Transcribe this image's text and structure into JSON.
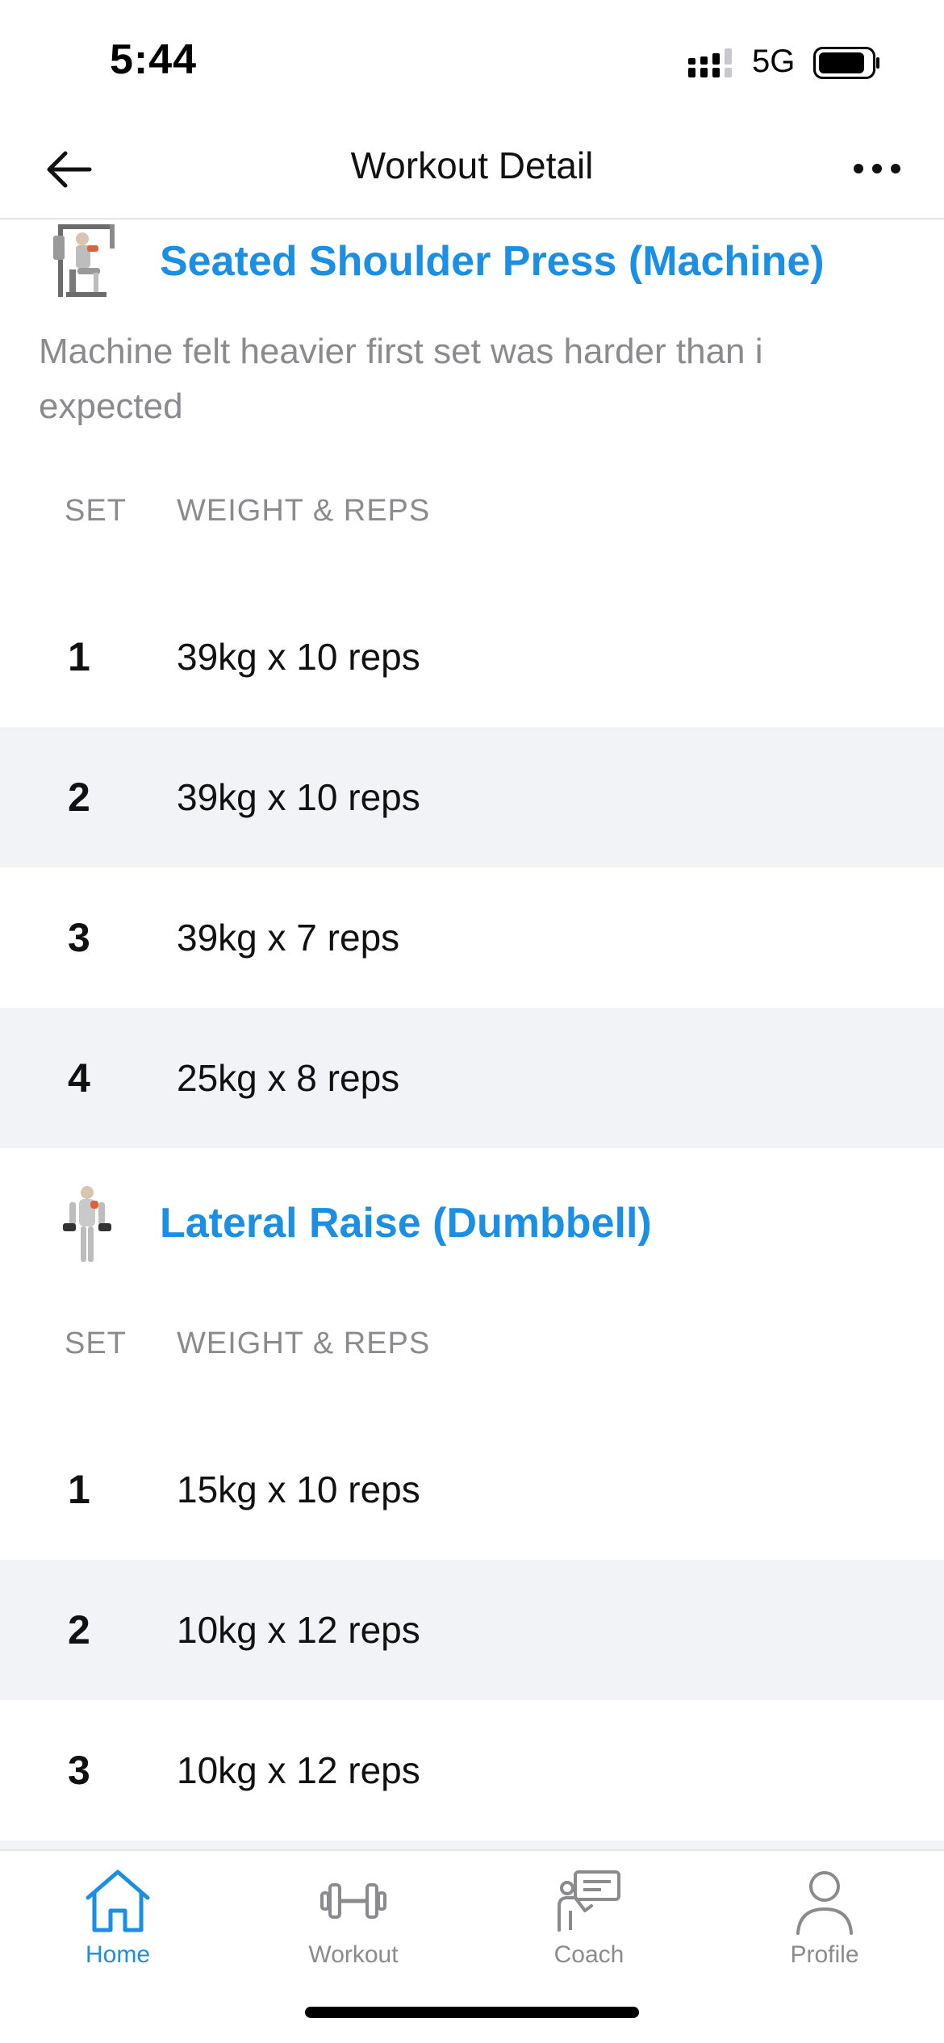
{
  "status_bar": {
    "time": "5:44",
    "network": "5G",
    "signal_icon": "signal-bars-icon",
    "battery_icon": "battery-icon"
  },
  "header": {
    "title": "Workout Detail",
    "back_icon": "arrow-left-icon",
    "more_icon": "ellipsis-icon"
  },
  "columns": {
    "set": "SET",
    "weight_reps": "WEIGHT & REPS"
  },
  "exercises": [
    {
      "title": "Seated Shoulder Press (Machine)",
      "thumbnail_icon": "shoulder-press-machine-icon",
      "note": "Machine felt heavier first set was harder than i expected",
      "sets": [
        {
          "number": "1",
          "value": "39kg x 10 reps"
        },
        {
          "number": "2",
          "value": "39kg x 10 reps"
        },
        {
          "number": "3",
          "value": "39kg x 7 reps"
        },
        {
          "number": "4",
          "value": "25kg x 8 reps"
        }
      ]
    },
    {
      "title": "Lateral Raise (Dumbbell)",
      "thumbnail_icon": "lateral-raise-dumbbell-icon",
      "note": "",
      "sets": [
        {
          "number": "1",
          "value": "15kg x 10 reps"
        },
        {
          "number": "2",
          "value": "10kg x 12 reps"
        },
        {
          "number": "3",
          "value": "10kg x 12 reps"
        }
      ]
    }
  ],
  "tab_bar": {
    "items": [
      {
        "label": "Home",
        "icon": "home-icon",
        "active": true
      },
      {
        "label": "Workout",
        "icon": "dumbbell-icon",
        "active": false
      },
      {
        "label": "Coach",
        "icon": "coach-icon",
        "active": false
      },
      {
        "label": "Profile",
        "icon": "person-icon",
        "active": false
      }
    ]
  },
  "colors": {
    "accent": "#1a8fe3",
    "muted_text": "#8b8b8f",
    "row_alt_bg": "#f2f3f6"
  }
}
